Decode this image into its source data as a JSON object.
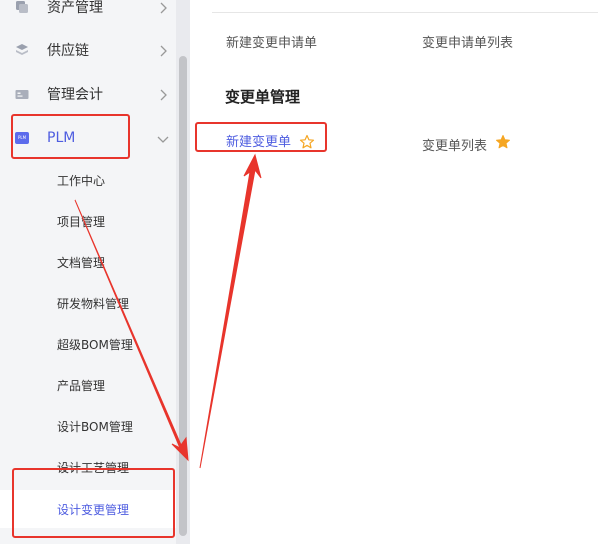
{
  "sidebar": {
    "menus": [
      {
        "label": "资产管理",
        "icon": "asset-icon"
      },
      {
        "label": "供应链",
        "icon": "supply-chain-icon"
      },
      {
        "label": "管理会计",
        "icon": "accounting-icon"
      },
      {
        "label": "PLM",
        "icon": "plm-icon",
        "icon_text": "PLM",
        "expanded": true
      }
    ],
    "submenu": [
      {
        "label": "工作中心"
      },
      {
        "label": "项目管理"
      },
      {
        "label": "文档管理"
      },
      {
        "label": "研发物料管理"
      },
      {
        "label": "超级BOM管理"
      },
      {
        "label": "产品管理"
      },
      {
        "label": "设计BOM管理"
      },
      {
        "label": "设计工艺管理"
      },
      {
        "label": "设计变更管理",
        "active": true
      }
    ]
  },
  "main": {
    "change_request": {
      "new_label": "新建变更申请单",
      "list_label": "变更申请单列表"
    },
    "change_order": {
      "title": "变更单管理",
      "new_label": "新建变更单",
      "list_label": "变更单列表",
      "new_favorited": false,
      "list_favorited": true
    }
  },
  "colors": {
    "accent": "#4e5de0",
    "highlight_box": "#e8352c",
    "star_filled": "#f5a623",
    "star_outline": "#f5a623",
    "sidebar_bg": "#f4f5f7"
  }
}
